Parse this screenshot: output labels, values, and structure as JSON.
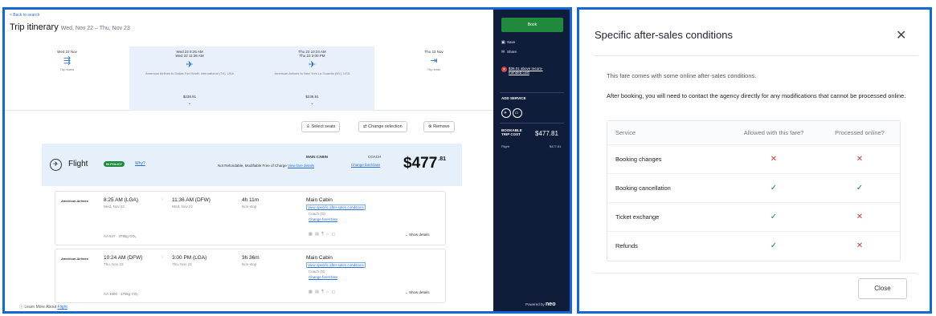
{
  "colors": {
    "accent": "#1268d4",
    "sidebar": "#0f1c3a",
    "book": "#1f8a3b",
    "ok": "#1f8a3b",
    "no": "#d63d3d"
  },
  "header": {
    "back": "< Back to search",
    "title": "Trip itinerary",
    "dates": "Wed, Nov 22 – Thu, Nov 23"
  },
  "timeline": {
    "start": {
      "date": "Wed 22 Nov",
      "sub": "Trip starts"
    },
    "out": {
      "date1": "Wed 22  8:25 AM",
      "date2": "Wed 22  11:36 AM",
      "route": "American Airlines to Dallas Fort Worth International (TX), USA",
      "price": "$238.91"
    },
    "ret": {
      "date1": "Thu 23  10:24 AM",
      "date2": "Thu 23  3:00 PM",
      "route": "American Airlines to New York La Guardia (NY), USA",
      "price": "$238.91"
    },
    "end": {
      "date": "Thu 23 Nov",
      "sub": "Trip ends"
    }
  },
  "actions": {
    "seats": "Select seats",
    "change": "Change selection",
    "remove": "Remove"
  },
  "flight_bar": {
    "label": "Flight",
    "policy": "IN POLICY",
    "why": "Why?",
    "fare_text": "Not Refundable, Modifiable Free of Charge",
    "fare_link": "View fare details",
    "cabin": "MAIN CABIN",
    "coach": "COACH",
    "change_fare": "Change fare/class",
    "price_main": "$477",
    "price_cents": ".81"
  },
  "segments": [
    {
      "airline": "American Airlines",
      "dep": "8:25 AM (LGA)",
      "dep_date": "Wed, Nov 22",
      "arr": "11:36 AM (DFW)",
      "arr_date": "Wed, Nov 22",
      "dur": "4h 11m",
      "stops": "Non-stop",
      "cabin": "Main Cabin",
      "cond": "View specific after-sales conditions",
      "cls": "Coach (G)",
      "change": "Change fare/class",
      "co2": "AA 547 · 379kg CO₂",
      "show": "Show details"
    },
    {
      "airline": "American Airlines",
      "dep": "10:24 AM (DFW)",
      "dep_date": "Thu, Nov 23",
      "arr": "3:00 PM (LGA)",
      "arr_date": "Thu, Nov 23",
      "dur": "3h 36m",
      "stops": "Non-stop",
      "cabin": "Main Cabin",
      "cond": "View specific after-sales conditions",
      "cls": "Coach (N)",
      "change": "Change fare/class",
      "co2": "AA 1600 · 379kg CO₂",
      "show": "Show details"
    }
  ],
  "learn": {
    "text": "Learn More About",
    "link": "Flight"
  },
  "sidebar": {
    "book": "Book",
    "save": "Save",
    "share": "Share",
    "warn": "$36.01 above recom- mended cost",
    "add_service": "ADD SERVICE",
    "cost_label": "BOOKABLE TRIP COST",
    "cost_value": "$477.81",
    "flight_label": "Flight",
    "flight_value": "$477.81",
    "powered": "Powered by",
    "brand": "neo"
  },
  "modal": {
    "title": "Specific after-sales conditions",
    "p1": "This fare comes with some online after-sales conditions.",
    "p2": "After booking, you will need to contact the agency directly for any modifications that cannot be processed online.",
    "headers": [
      "Service",
      "Allowed with this fare?",
      "Processed online?"
    ],
    "rows": [
      {
        "service": "Booking changes",
        "allowed": "✕",
        "online": "✕"
      },
      {
        "service": "Booking cancellation",
        "allowed": "✓",
        "online": "✓"
      },
      {
        "service": "Ticket exchange",
        "allowed": "✓",
        "online": "✕"
      },
      {
        "service": "Refunds",
        "allowed": "✓",
        "online": "✕"
      }
    ],
    "close": "Close"
  }
}
